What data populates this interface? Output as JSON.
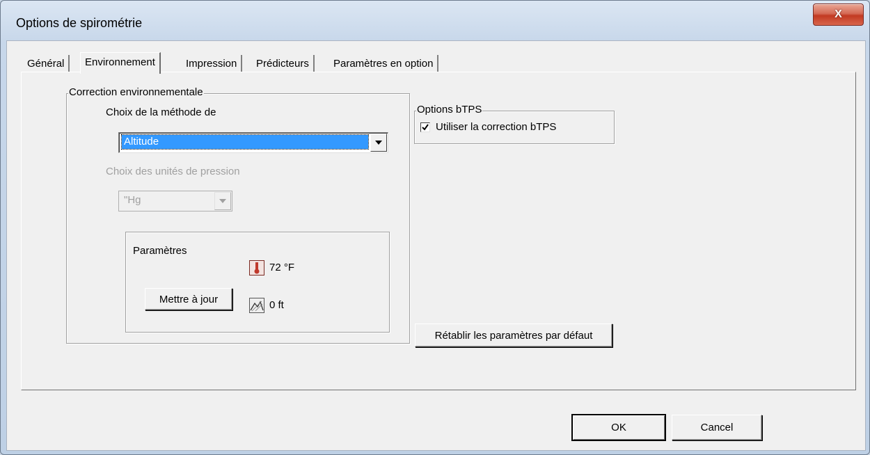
{
  "window": {
    "title": "Options de spirométrie",
    "close_label": "X"
  },
  "tabs": [
    {
      "label": "Général"
    },
    {
      "label": "Environnement"
    },
    {
      "label": "Impression"
    },
    {
      "label": "Prédicteurs"
    },
    {
      "label": "Paramètres en option"
    }
  ],
  "env_group": {
    "legend": "Correction environnementale",
    "method_label": "Choix de la méthode de",
    "method_value": "Altitude",
    "pressure_label": "Choix des unités de pression",
    "pressure_value": "\"Hg",
    "params": {
      "title": "Paramètres",
      "temperature": "72 °F",
      "altitude": "0 ft",
      "update_button": "Mettre à jour"
    }
  },
  "btps_group": {
    "legend": "Options bTPS",
    "checkbox_label": "Utiliser la correction bTPS",
    "checked": true
  },
  "restore_button": "Rétablir les paramètres par défaut",
  "footer": {
    "ok": "OK",
    "cancel": "Cancel"
  }
}
